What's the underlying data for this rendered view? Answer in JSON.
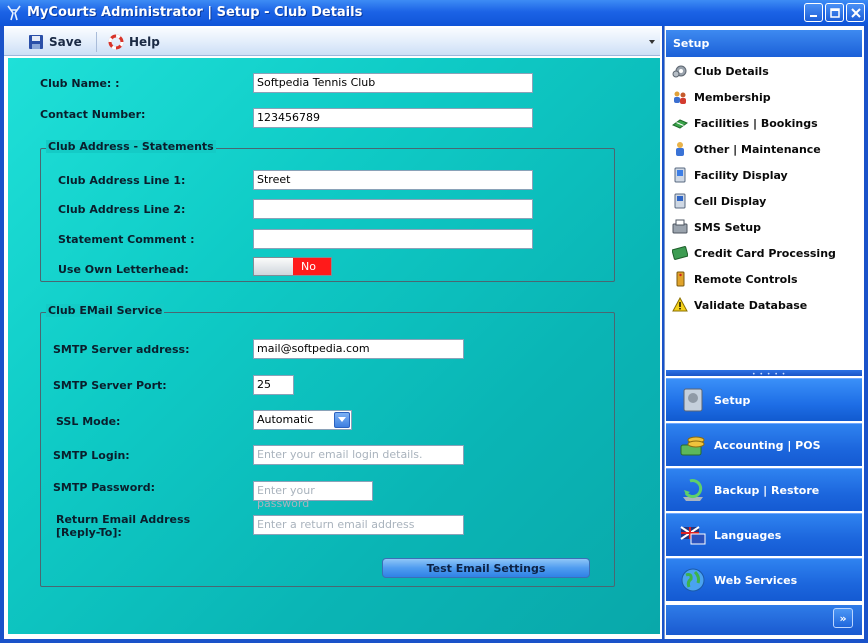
{
  "window": {
    "title": "MyCourts Administrator | Setup - Club Details"
  },
  "toolbar": {
    "save_label": "Save",
    "help_label": "Help"
  },
  "form": {
    "club_name_label": "Club Name: :",
    "club_name_value": "Softpedia Tennis Club",
    "contact_label": "Contact Number:",
    "contact_value": "123456789",
    "address_group": {
      "title": "Club Address - Statements",
      "line1_label": "Club Address Line 1:",
      "line1_value": "Street",
      "line2_label": "Club Address Line 2:",
      "line2_value": "",
      "statement_label": "Statement Comment :",
      "statement_value": "",
      "letterhead_label": "Use Own Letterhead:",
      "letterhead_value": "No"
    },
    "email_group": {
      "title": "Club EMail Service",
      "smtp_server_label": "SMTP Server address:",
      "smtp_server_value": "mail@softpedia.com",
      "smtp_port_label": "SMTP Server Port:",
      "smtp_port_value": "25",
      "ssl_label": "SSL Mode:",
      "ssl_value": "Automatic",
      "login_label": "SMTP Login:",
      "login_placeholder": "Enter your email login details.",
      "password_label": "SMTP Password:",
      "password_placeholder": "Enter your password",
      "return_label_1": "Return Email Address",
      "return_label_2": "[Reply-To]:",
      "return_placeholder": "Enter a return email address",
      "test_button": "Test Email Settings"
    }
  },
  "sidebar": {
    "header": "Setup",
    "items": [
      {
        "label": "Club Details"
      },
      {
        "label": "Membership"
      },
      {
        "label": "Facilities | Bookings"
      },
      {
        "label": "Other | Maintenance"
      },
      {
        "label": "Facility Display"
      },
      {
        "label": "Cell Display"
      },
      {
        "label": "SMS Setup"
      },
      {
        "label": "Credit Card Processing"
      },
      {
        "label": "Remote Controls"
      },
      {
        "label": "Validate Database"
      }
    ],
    "modules": [
      {
        "label": "Setup"
      },
      {
        "label": "Accounting | POS"
      },
      {
        "label": "Backup | Restore"
      },
      {
        "label": "Languages"
      },
      {
        "label": "Web Services"
      }
    ]
  },
  "colors": {
    "accent": "#1c63e6",
    "form_bg": "#14cbc6",
    "toggle_off": "#ff1a1a"
  }
}
